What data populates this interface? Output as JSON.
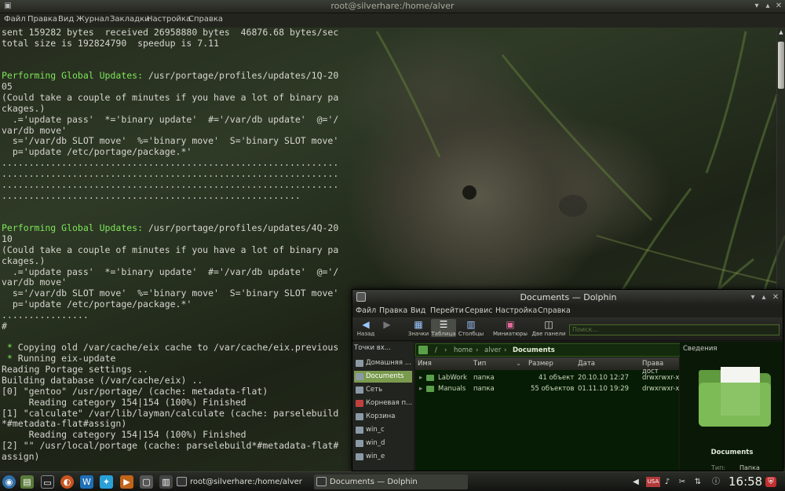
{
  "terminal": {
    "title": "root@silverhare:/home/alver",
    "menu": [
      "Файл",
      "Правка",
      "Вид",
      "Журнал",
      "Закладки",
      "Настройка",
      "Справка"
    ],
    "lines": [
      [
        {
          "t": "sent 159282 bytes  received 26958880 bytes  46876.68 bytes/sec"
        }
      ],
      [
        {
          "t": "total size is 192824790  speedup is 7.11"
        }
      ],
      [
        {
          "t": ""
        }
      ],
      [
        {
          "t": ""
        }
      ],
      [
        {
          "t": "Performing Global Updates: ",
          "c": "g"
        },
        {
          "t": "/usr/portage/profiles/updates/1Q-20"
        }
      ],
      [
        {
          "t": "05"
        }
      ],
      [
        {
          "t": "(Could take a couple of minutes if you have a lot of binary pa"
        }
      ],
      [
        {
          "t": "ckages.)"
        }
      ],
      [
        {
          "t": "  .='update pass'  *='binary update'  #='/var/db update'  @='/"
        }
      ],
      [
        {
          "t": "var/db move'"
        }
      ],
      [
        {
          "t": "  s='/var/db SLOT move'  %='binary move'  S='binary SLOT move'"
        }
      ],
      [
        {
          "t": "  p='update /etc/portage/package.*'"
        }
      ],
      [
        {
          "t": ".............................................................."
        }
      ],
      [
        {
          "t": ".............................................................."
        }
      ],
      [
        {
          "t": ".............................................................."
        }
      ],
      [
        {
          "t": "......................................................."
        }
      ],
      [
        {
          "t": ""
        }
      ],
      [
        {
          "t": ""
        }
      ],
      [
        {
          "t": "Performing Global Updates: ",
          "c": "g"
        },
        {
          "t": "/usr/portage/profiles/updates/4Q-20"
        }
      ],
      [
        {
          "t": "10"
        }
      ],
      [
        {
          "t": "(Could take a couple of minutes if you have a lot of binary pa"
        }
      ],
      [
        {
          "t": "ckages.)"
        }
      ],
      [
        {
          "t": "  .='update pass'  *='binary update'  #='/var/db update'  @='/"
        }
      ],
      [
        {
          "t": "var/db move'"
        }
      ],
      [
        {
          "t": "  s='/var/db SLOT move'  %='binary move'  S='binary SLOT move'"
        }
      ],
      [
        {
          "t": "  p='update /etc/portage/package.*'"
        }
      ],
      [
        {
          "t": "................"
        }
      ],
      [
        {
          "t": "#"
        }
      ],
      [
        {
          "t": ""
        }
      ],
      [
        {
          "t": " * ",
          "c": "g"
        },
        {
          "t": "Copying old /var/cache/eix cache to /var/cache/eix.previous"
        }
      ],
      [
        {
          "t": " * ",
          "c": "g"
        },
        {
          "t": "Running eix-update"
        }
      ],
      [
        {
          "t": "Reading Portage settings .."
        }
      ],
      [
        {
          "t": "Building database (/var/cache/eix) .."
        }
      ],
      [
        {
          "t": "[0] \"gentoo\" /usr/portage/ (cache: metadata-flat)"
        }
      ],
      [
        {
          "t": "     Reading category 154|154 (100%) Finished"
        }
      ],
      [
        {
          "t": "[1] \"calculate\" /var/lib/layman/calculate (cache: parselebuild"
        }
      ],
      [
        {
          "t": "*#metadata-flat#assign)"
        }
      ],
      [
        {
          "t": "     Reading category 154|154 (100%) Finished"
        }
      ],
      [
        {
          "t": "[2] \"\" /usr/local/portage (cache: parselebuild*#metadata-flat#"
        }
      ],
      [
        {
          "t": "assign)"
        }
      ]
    ]
  },
  "dolphin": {
    "title": "Documents — Dolphin",
    "menu": [
      "Файл",
      "Правка",
      "Вид",
      "Перейти",
      "Сервис",
      "Настройка",
      "Справка"
    ],
    "toolbar": {
      "back": "Назад",
      "icons": "Значки",
      "table": "Таблица",
      "columns": "Столбцы",
      "thumbnails": "Миниатюры",
      "split": "Две панели",
      "search_placeholder": "Поиск..."
    },
    "places": {
      "header": "Точки вх...",
      "items": [
        "Домашняя ...",
        "Documents",
        "Сеть",
        "Корневая п...",
        "Корзина",
        "win_c",
        "win_d",
        "win_e"
      ]
    },
    "breadcrumb": [
      "/",
      "home",
      "alver",
      "Documents"
    ],
    "columns": [
      "Имя",
      "Тип",
      "Размер",
      "Дата",
      "Права дост"
    ],
    "rows": [
      {
        "name": "LabWork",
        "type": "папка",
        "size": "41 объект",
        "date": "20.10.10 12:27",
        "perms": "drwxrwxr-x"
      },
      {
        "name": "Manuals",
        "type": "папка",
        "size": "55 объектов",
        "date": "01.11.10 19:29",
        "perms": "drwxrwxr-x"
      }
    ],
    "info": {
      "header": "Сведения",
      "name": "Documents",
      "type_label": "Тип:",
      "type_value": "Папка"
    }
  },
  "taskbar": {
    "tasks": [
      "root@silverhare:/home/alver",
      "Documents — Dolphin"
    ],
    "keyboard": "USA",
    "clock": "16:58"
  }
}
